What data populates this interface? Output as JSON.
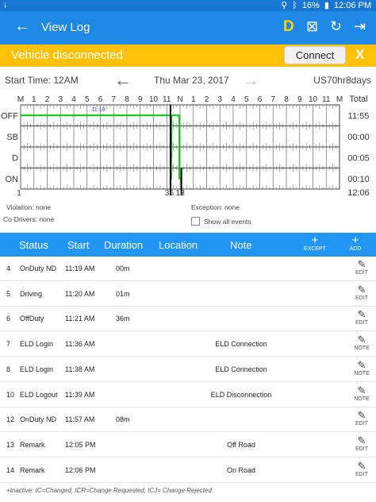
{
  "status_bar": {
    "left": "↓",
    "battery": "16%",
    "time": "12:06 PM"
  },
  "app_bar": {
    "title": "View Log",
    "mode_letter": "D"
  },
  "banner": {
    "message": "Vehicle disconnected",
    "button": "Connect",
    "dismiss": "X",
    "color": "#ffc107"
  },
  "date_bar": {
    "start_time": "Start Time: 12AM",
    "date": "Thu Mar 23, 2017",
    "cycle": "US70hr8days"
  },
  "graph": {
    "hour_labels": [
      "M",
      "1",
      "2",
      "3",
      "4",
      "5",
      "6",
      "7",
      "8",
      "9",
      "10",
      "11",
      "N",
      "1",
      "2",
      "3",
      "4",
      "5",
      "6",
      "7",
      "8",
      "9",
      "10",
      "11",
      "M"
    ],
    "total_label": "Total",
    "rows": [
      {
        "label": "OFF",
        "total": "11:55"
      },
      {
        "label": "SB",
        "total": "00:00"
      },
      {
        "label": "D",
        "total": "00:05"
      },
      {
        "label": "ON",
        "total": "00:10"
      }
    ],
    "grand_total": "12:06",
    "bottom_left": "1",
    "bottom_marker": "36 18",
    "top_marker": "11:19",
    "line_color": "#00c800"
  },
  "meta": {
    "violation": "Violation: none",
    "co_drivers": "Co-Drivers: none",
    "exception": "Exception: none",
    "show_all": "Show all events"
  },
  "table": {
    "headers": {
      "status": "Status",
      "start": "Start",
      "duration": "Duration",
      "location": "Location",
      "note": "Note"
    },
    "except_label": "EXCEPT",
    "add_label": "ADD",
    "rows": [
      {
        "num": "4",
        "status": "OnDuty ND",
        "start": "11:19 AM",
        "duration": "00m",
        "note": "",
        "action": "EDIT"
      },
      {
        "num": "5",
        "status": "Driving",
        "start": "11:20 AM",
        "duration": "01m",
        "note": "",
        "action": "EDIT"
      },
      {
        "num": "6",
        "status": "OffDuty",
        "start": "11:21 AM",
        "duration": "36m",
        "note": "",
        "action": "EDIT"
      },
      {
        "num": "7",
        "status": "ELD Login",
        "start": "11:36 AM",
        "duration": "",
        "note": "ELD Connection",
        "action": "NOTE"
      },
      {
        "num": "8",
        "status": "ELD Login",
        "start": "11:38 AM",
        "duration": "",
        "note": "ELD Connection",
        "action": "NOTE"
      },
      {
        "num": "10",
        "status": "ELD Logout",
        "start": "11:39 AM",
        "duration": "",
        "note": "ELD Disconnection",
        "action": "NOTE"
      },
      {
        "num": "12",
        "status": "OnDuty ND",
        "start": "11:57 AM",
        "duration": "08m",
        "note": "",
        "action": "EDIT"
      },
      {
        "num": "13",
        "status": "Remark",
        "start": "12:05 PM",
        "duration": "",
        "note": "Off Road",
        "action": "EDIT"
      },
      {
        "num": "14",
        "status": "Remark",
        "start": "12:06 PM",
        "duration": "",
        "note": "On Road",
        "action": "EDIT"
      }
    ]
  },
  "footer": "+Inactive: IC=Changed, ICR=Change Requested, ICJ= Change Rejected"
}
